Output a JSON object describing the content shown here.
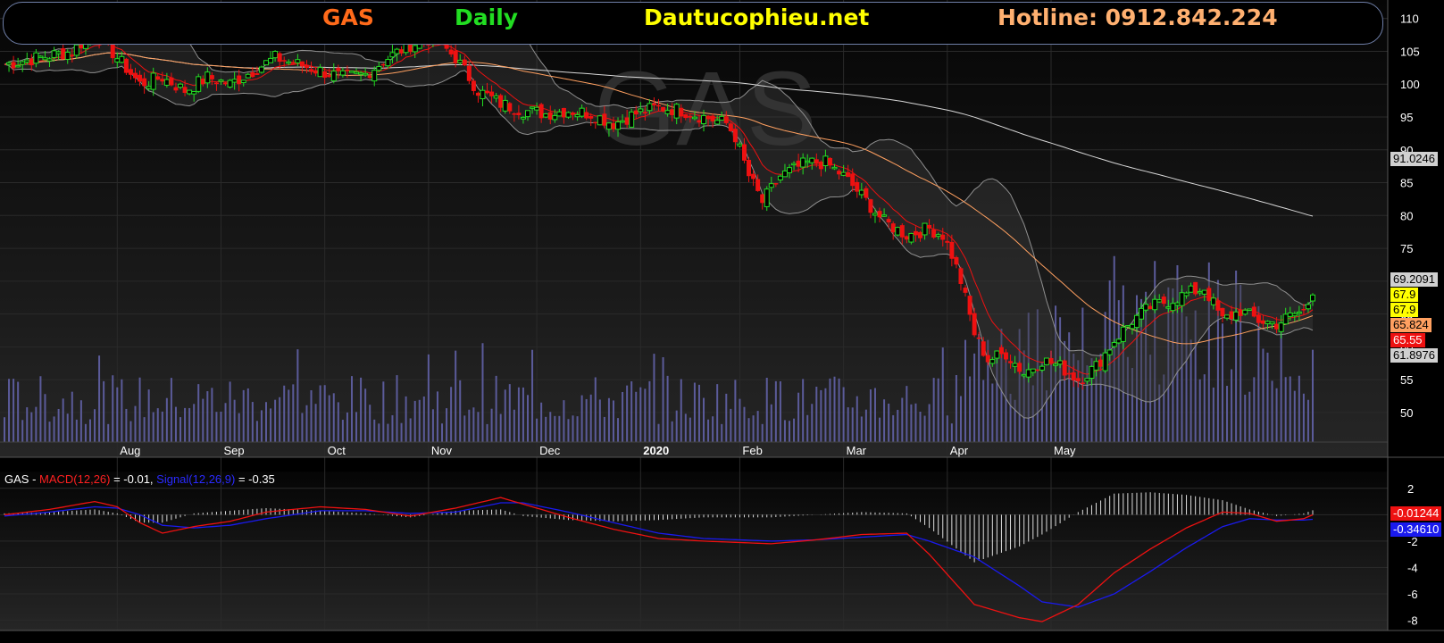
{
  "header": {
    "ticker": "GAS",
    "period": "Daily",
    "site": "Dautucophieu.net",
    "hotline": "Hotline: 0912.842.224",
    "ticker_color": "#ff6a1a",
    "period_color": "#22dd22",
    "site_color": "#ffff00",
    "hotline_color": "#ffb070"
  },
  "watermark": "GAS",
  "macd_legend": {
    "prefix": "GAS - ",
    "macd_label": "MACD(12,26)",
    "macd_value": " = -0.01, ",
    "signal_label": "Signal(12,26,9)",
    "signal_value": " = -0.35"
  },
  "price_badges": [
    {
      "text": "91.0246",
      "bg": "#d0d0d0",
      "fg": "#000000"
    },
    {
      "text": "69.2091",
      "bg": "#d0d0d0",
      "fg": "#000000"
    },
    {
      "text": "67.9",
      "bg": "#ffff00",
      "fg": "#000000"
    },
    {
      "text": "67.9",
      "bg": "#ffff00",
      "fg": "#000000"
    },
    {
      "text": "65.824",
      "bg": "#ffa060",
      "fg": "#000000"
    },
    {
      "text": "65.55",
      "bg": "#ee1111",
      "fg": "#ffffff"
    },
    {
      "text": "61.8976",
      "bg": "#d0d0d0",
      "fg": "#000000"
    }
  ],
  "macd_badges": [
    {
      "text": "-0.01244",
      "bg": "#ee1111",
      "fg": "#ffffff"
    },
    {
      "text": "-0.34610",
      "bg": "#1a1aee",
      "fg": "#ffffff"
    }
  ],
  "chart_data": [
    {
      "type": "candlestick",
      "title": "GAS Daily",
      "x_labels": [
        "Aug",
        "Sep",
        "Oct",
        "Nov",
        "Dec",
        "2020",
        "Feb",
        "Mar",
        "Apr",
        "May"
      ],
      "y_ticks": [
        50,
        55,
        60,
        65,
        70,
        75,
        80,
        85,
        90,
        95,
        100,
        105,
        110
      ],
      "ylim": [
        45.5,
        112
      ],
      "grid": true,
      "last_close": 67.9,
      "overlays": [
        {
          "name": "EMA short",
          "color": "#ee1111",
          "last": 65.55
        },
        {
          "name": "MA mid",
          "color": "#ffa060",
          "last": 65.824
        },
        {
          "name": "MA long",
          "color": "#d0d0d0",
          "last": 91.0246
        },
        {
          "name": "Bollinger upper",
          "color": "#a0a0a0",
          "last": 69.2091
        },
        {
          "name": "Bollinger lower",
          "color": "#a0a0a0",
          "last": 61.8976
        }
      ],
      "price_path": [
        [
          0,
          103
        ],
        [
          15,
          105
        ],
        [
          20,
          108
        ],
        [
          25,
          104
        ],
        [
          30,
          100
        ],
        [
          35,
          101
        ],
        [
          40,
          99
        ],
        [
          45,
          101
        ],
        [
          50,
          100
        ],
        [
          55,
          102
        ],
        [
          60,
          104
        ],
        [
          65,
          103
        ],
        [
          70,
          102
        ],
        [
          75,
          101
        ],
        [
          80,
          101.5
        ],
        [
          85,
          104
        ],
        [
          90,
          106
        ],
        [
          95,
          107
        ],
        [
          100,
          104
        ],
        [
          105,
          99
        ],
        [
          110,
          97
        ],
        [
          115,
          96
        ],
        [
          120,
          95.5
        ],
        [
          125,
          96
        ],
        [
          130,
          95.5
        ],
        [
          135,
          94
        ],
        [
          140,
          95.5
        ],
        [
          145,
          96.5
        ],
        [
          150,
          96
        ],
        [
          155,
          95
        ],
        [
          160,
          94
        ],
        [
          162,
          92
        ],
        [
          165,
          86
        ],
        [
          168,
          82
        ],
        [
          172,
          86
        ],
        [
          178,
          88
        ],
        [
          182,
          88
        ],
        [
          186,
          86
        ],
        [
          190,
          83
        ],
        [
          195,
          79
        ],
        [
          200,
          77
        ],
        [
          205,
          78
        ],
        [
          208,
          77
        ],
        [
          210,
          74
        ],
        [
          212,
          70
        ],
        [
          215,
          62
        ],
        [
          218,
          58
        ],
        [
          222,
          59
        ],
        [
          226,
          56
        ],
        [
          230,
          58
        ],
        [
          234,
          57
        ],
        [
          238,
          55
        ],
        [
          242,
          57
        ],
        [
          246,
          61
        ],
        [
          250,
          64
        ],
        [
          254,
          66
        ],
        [
          258,
          67
        ],
        [
          262,
          68
        ],
        [
          266,
          69
        ],
        [
          270,
          64
        ],
        [
          274,
          65.5
        ],
        [
          278,
          64
        ],
        [
          282,
          63.5
        ],
        [
          286,
          65
        ],
        [
          288,
          65.5
        ],
        [
          290,
          67.9
        ]
      ],
      "volume_profile": "moderate through 2019, rising sharply from March 2020 with peaks in April 2020"
    },
    {
      "type": "line",
      "title": "GAS - MACD(12,26) = -0.01, Signal(12,26,9) = -0.35",
      "y_ticks": [
        2,
        0,
        -2,
        -4,
        -6,
        -8
      ],
      "ylim": [
        -8.5,
        3
      ],
      "grid": true,
      "series": [
        {
          "name": "MACD(12,26)",
          "color": "#ee1111",
          "last": -0.01244
        },
        {
          "name": "Signal(12,26,9)",
          "color": "#1a1aee",
          "last": -0.3461
        }
      ],
      "macd_path": [
        [
          0,
          0
        ],
        [
          10,
          0.4
        ],
        [
          20,
          1.0
        ],
        [
          25,
          0.6
        ],
        [
          30,
          -0.6
        ],
        [
          35,
          -1.4
        ],
        [
          42,
          -0.9
        ],
        [
          50,
          -0.5
        ],
        [
          58,
          0.2
        ],
        [
          70,
          0.6
        ],
        [
          80,
          0.4
        ],
        [
          90,
          -0.1
        ],
        [
          100,
          0.5
        ],
        [
          110,
          1.3
        ],
        [
          115,
          0.8
        ],
        [
          125,
          -0.2
        ],
        [
          135,
          -1.1
        ],
        [
          145,
          -1.8
        ],
        [
          155,
          -2.0
        ],
        [
          170,
          -2.2
        ],
        [
          180,
          -1.9
        ],
        [
          190,
          -1.5
        ],
        [
          200,
          -1.4
        ],
        [
          205,
          -3.0
        ],
        [
          215,
          -6.8
        ],
        [
          225,
          -7.8
        ],
        [
          230,
          -8.1
        ],
        [
          238,
          -6.8
        ],
        [
          246,
          -4.4
        ],
        [
          254,
          -2.6
        ],
        [
          262,
          -1.0
        ],
        [
          270,
          0.2
        ],
        [
          276,
          0.1
        ],
        [
          282,
          -0.5
        ],
        [
          288,
          -0.3
        ],
        [
          290,
          -0.01
        ]
      ],
      "signal_path": [
        [
          0,
          -0.1
        ],
        [
          10,
          0.2
        ],
        [
          20,
          0.6
        ],
        [
          25,
          0.5
        ],
        [
          30,
          0
        ],
        [
          35,
          -0.8
        ],
        [
          42,
          -1.0
        ],
        [
          50,
          -0.8
        ],
        [
          58,
          -0.3
        ],
        [
          70,
          0.3
        ],
        [
          80,
          0.3
        ],
        [
          90,
          0.1
        ],
        [
          100,
          0.2
        ],
        [
          110,
          0.9
        ],
        [
          115,
          0.9
        ],
        [
          125,
          0.2
        ],
        [
          135,
          -0.6
        ],
        [
          145,
          -1.4
        ],
        [
          155,
          -1.8
        ],
        [
          170,
          -2.0
        ],
        [
          180,
          -1.9
        ],
        [
          190,
          -1.7
        ],
        [
          200,
          -1.5
        ],
        [
          205,
          -2.0
        ],
        [
          215,
          -3.2
        ],
        [
          225,
          -5.4
        ],
        [
          230,
          -6.6
        ],
        [
          238,
          -7.0
        ],
        [
          246,
          -6.0
        ],
        [
          254,
          -4.3
        ],
        [
          262,
          -2.5
        ],
        [
          270,
          -0.9
        ],
        [
          276,
          -0.3
        ],
        [
          282,
          -0.4
        ],
        [
          288,
          -0.4
        ],
        [
          290,
          -0.35
        ]
      ]
    }
  ]
}
